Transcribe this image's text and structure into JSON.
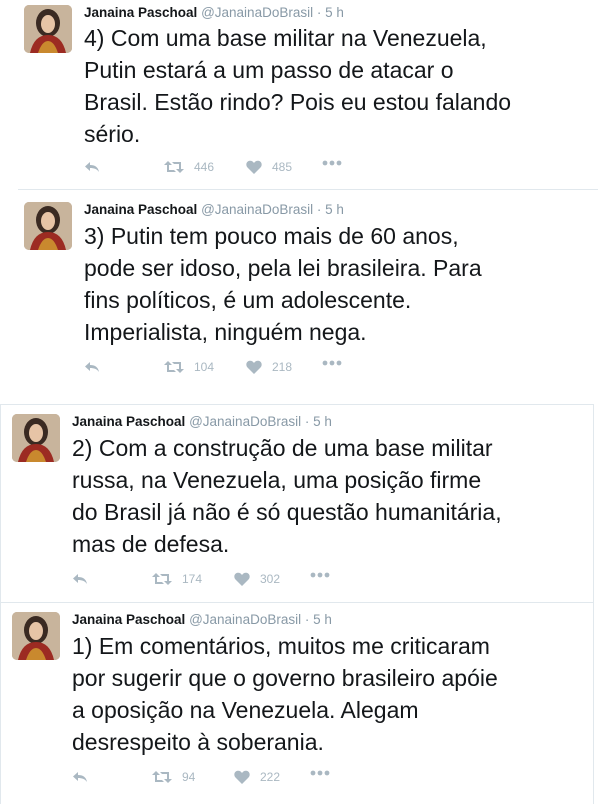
{
  "tweets": [
    {
      "author_name": "Janaina Paschoal",
      "handle": "@JanainaDoBrasil",
      "separator": "·",
      "time": "5 h",
      "lines": [
        "4) Com uma base militar na Venezuela,",
        "Putin estará a um passo de atacar o",
        "Brasil. Estão rindo? Pois eu estou falando",
        "sério."
      ],
      "retweets": "446",
      "likes": "485"
    },
    {
      "author_name": "Janaina Paschoal",
      "handle": "@JanainaDoBrasil",
      "separator": "·",
      "time": "5 h",
      "lines": [
        "3) Putin tem pouco mais de 60 anos,",
        "pode ser idoso, pela lei brasileira. Para",
        "fins políticos, é um adolescente.",
        "Imperialista, ninguém nega."
      ],
      "retweets": "104",
      "likes": "218"
    },
    {
      "author_name": "Janaina Paschoal",
      "handle": "@JanainaDoBrasil",
      "separator": "·",
      "time": "5 h",
      "lines": [
        "2) Com a construção de uma base militar",
        "russa, na Venezuela, uma posição firme",
        "do Brasil já não é só questão humanitária,",
        "mas de defesa."
      ],
      "retweets": "174",
      "likes": "302"
    },
    {
      "author_name": "Janaina Paschoal",
      "handle": "@JanainaDoBrasil",
      "separator": "·",
      "time": "5 h",
      "lines": [
        "1) Em comentários, muitos me criticaram",
        "por sugerir que o governo brasileiro apóie",
        "a oposição na Venezuela. Alegam",
        "desrespeito à soberania."
      ],
      "retweets": "94",
      "likes": "222"
    }
  ],
  "icons": {
    "reply": "reply-icon",
    "retweet": "retweet-icon",
    "like": "heart-icon",
    "more": "more-icon"
  },
  "colors": {
    "text": "#14171a",
    "muted": "#8899a6",
    "action": "#aab8c2",
    "border": "#e1e8ed"
  }
}
